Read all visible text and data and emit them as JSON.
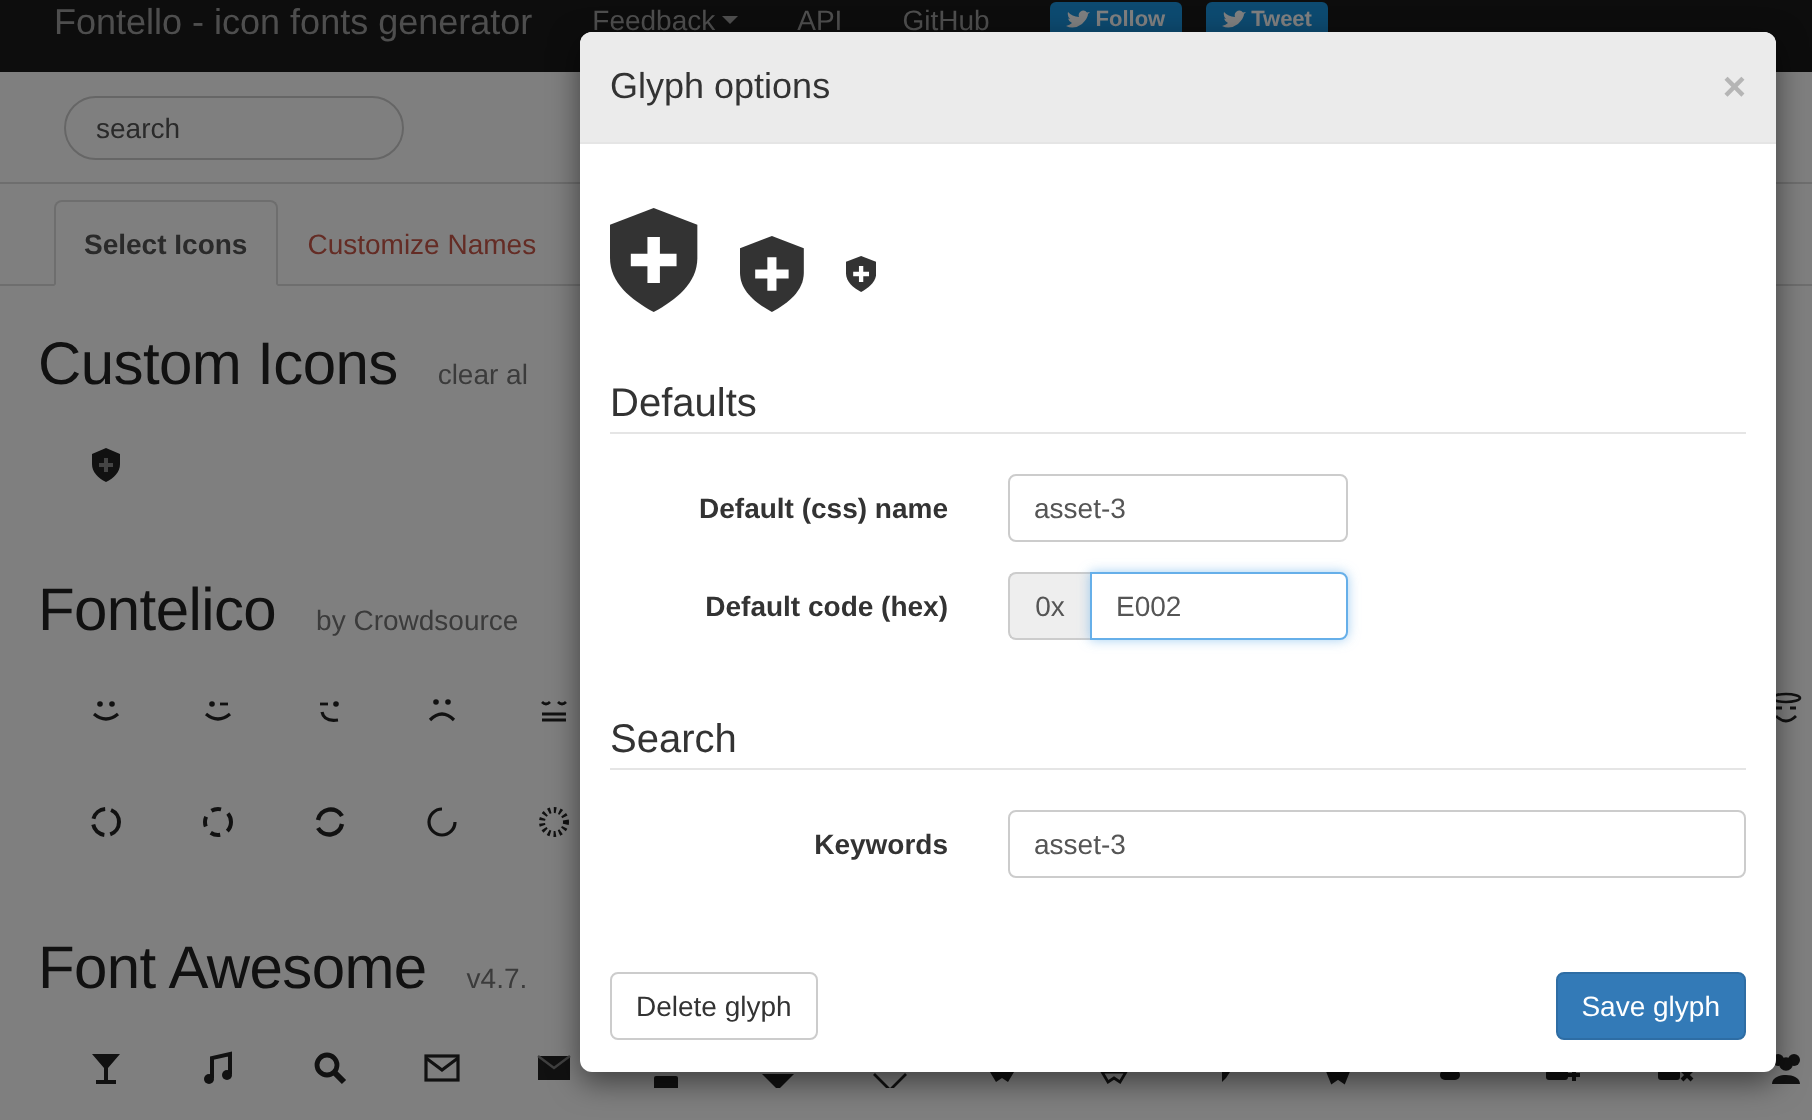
{
  "navbar": {
    "brand": "Fontello - icon fonts generator",
    "links": [
      {
        "label": "Feedback",
        "dropdown": true
      },
      {
        "label": "API",
        "dropdown": false
      },
      {
        "label": "GitHub",
        "dropdown": false
      }
    ],
    "social_buttons": [
      "Follow",
      "Tweet"
    ]
  },
  "search": {
    "placeholder": "search"
  },
  "tabs": [
    {
      "label": "Select Icons",
      "selected": true
    },
    {
      "label": "Customize Names",
      "selected": false
    }
  ],
  "sections": [
    {
      "title": "Custom Icons",
      "note": "clear al"
    },
    {
      "title": "Fontelico",
      "note": "by Crowdsource"
    },
    {
      "title": "Font Awesome",
      "note": "v4.7."
    }
  ],
  "modal": {
    "title": "Glyph options",
    "close": "×",
    "fieldsets": [
      {
        "legend": "Defaults",
        "fields": [
          {
            "label": "Default (css) name",
            "value": "asset-3",
            "focused": false,
            "kind": "short"
          },
          {
            "label": "Default code (hex)",
            "prefix": "0x",
            "value": "E002",
            "focused": true,
            "kind": "short"
          }
        ]
      },
      {
        "legend": "Search",
        "fields": [
          {
            "label": "Keywords",
            "value": "asset-3",
            "focused": false,
            "kind": "wide"
          }
        ]
      }
    ],
    "buttons": [
      {
        "label": "Delete glyph",
        "kind": "default"
      },
      {
        "label": "Save glyph",
        "kind": "primary"
      }
    ]
  }
}
